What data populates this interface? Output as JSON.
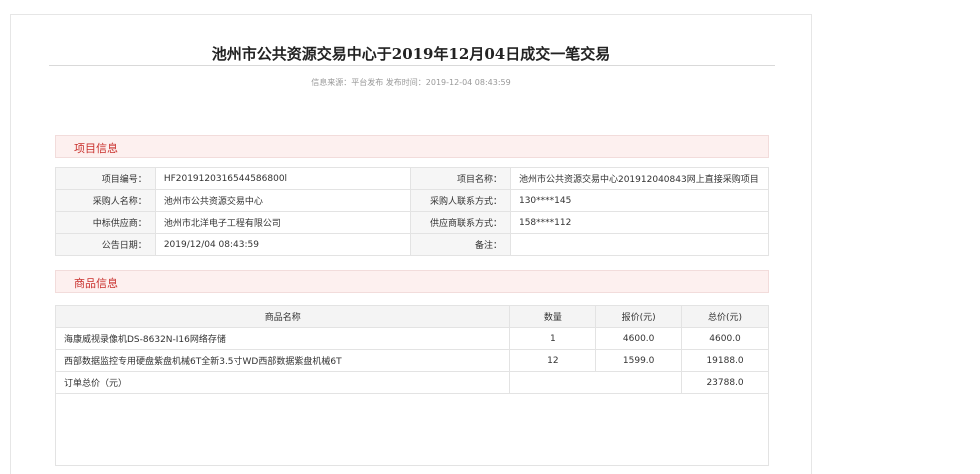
{
  "title": "池州市公共资源交易中心于2019年12月04日成交一笔交易",
  "meta": "信息来源：平台发布 发布时间：2019-12-04 08:43:59",
  "project_section": {
    "heading": "项目信息",
    "rows": [
      {
        "l1": "项目编号：",
        "v1": "HF2019120316544586800l",
        "l2": "项目名称：",
        "v2": "池州市公共资源交易中心201912040843网上直接采购项目"
      },
      {
        "l1": "采购人名称：",
        "v1": "池州市公共资源交易中心",
        "l2": "采购人联系方式：",
        "v2": "130****145"
      },
      {
        "l1": "中标供应商：",
        "v1": "池州市北洋电子工程有限公司",
        "l2": "供应商联系方式：",
        "v2": "158****112"
      },
      {
        "l1": "公告日期：",
        "v1": "2019/12/04 08:43:59",
        "l2": "备注：",
        "v2": ""
      }
    ]
  },
  "goods_section": {
    "heading": "商品信息",
    "columns": [
      "商品名称",
      "数量",
      "报价(元)",
      "总价(元)"
    ],
    "items": [
      {
        "name": "海康威视录像机DS-8632N-I16网络存储",
        "qty": "1",
        "price": "4600.0",
        "total": "4600.0"
      },
      {
        "name": "西部数据监控专用硬盘紫盘机械6T全新3.5寸WD西部数据紫盘机械6T",
        "qty": "12",
        "price": "1599.0",
        "total": "19188.0"
      }
    ],
    "order_total_label": "订单总价（元）",
    "order_total": "23788.0"
  }
}
